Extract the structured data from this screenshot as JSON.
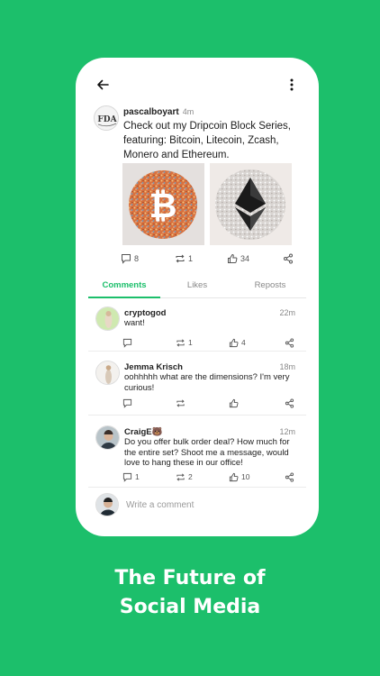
{
  "post": {
    "author": "pascalboyart",
    "time": "4m",
    "text": "Check out my Dripcoin Block Series, featuring: Bitcoin, Litecoin, Zcash, Monero and Ethereum.",
    "comments_count": "8",
    "reposts_count": "1",
    "likes_count": "34",
    "avatar_logo": "FDA"
  },
  "tabs": [
    {
      "label": "Comments",
      "active": true
    },
    {
      "label": "Likes",
      "active": false
    },
    {
      "label": "Reposts",
      "active": false
    }
  ],
  "comments": [
    {
      "name": "cryptogod",
      "time": "22m",
      "text": "want!",
      "replies": "",
      "reposts": "1",
      "likes": "4"
    },
    {
      "name": "Jemma Krisch",
      "time": "18m",
      "text": "oohhhhh what are the dimensions? I'm very curious!",
      "replies": "",
      "reposts": "",
      "likes": ""
    },
    {
      "name": "CraigE🐻",
      "time": "12m",
      "text": "Do you offer bulk order deal? How much for the entire set? Shoot me a message, would love to hang these in our office!",
      "replies": "1",
      "reposts": "2",
      "likes": "10"
    }
  ],
  "compose": {
    "placeholder": "Write a comment"
  },
  "headline": {
    "line1": "The Future of",
    "line2": "Social Media"
  },
  "colors": {
    "brand": "#1cbf6b",
    "text": "#222222",
    "muted": "#888888"
  }
}
